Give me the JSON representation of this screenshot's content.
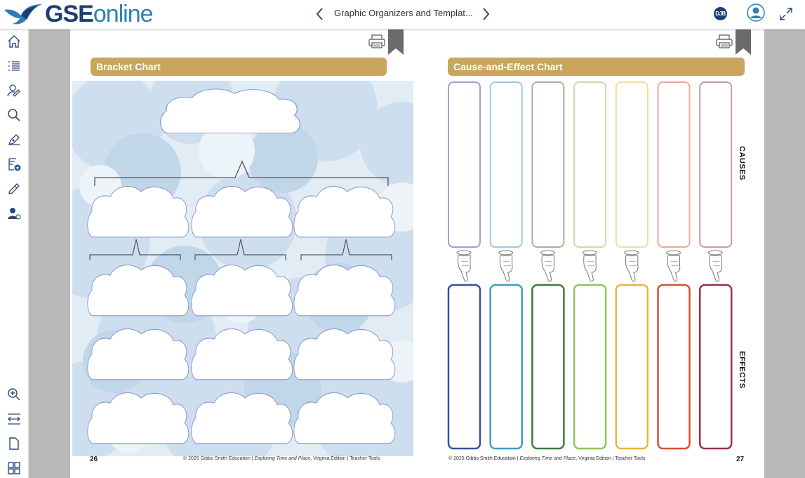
{
  "header": {
    "logo_gse": "GSE",
    "logo_online": "online",
    "doc_title": "Graphic Organizers and Templat...",
    "badge": "DJB"
  },
  "icons": {
    "prev": "chevron-left-icon",
    "next": "chevron-right-icon",
    "avatar": "user-avatar-icon",
    "expand": "fullscreen-expand-icon"
  },
  "sidebar": {
    "items": [
      "home",
      "table-of-contents",
      "student-work",
      "search",
      "annotate",
      "notes-add",
      "highlight",
      "assign",
      "zoom-in",
      "fit-width",
      "single-page",
      "thumbnails"
    ]
  },
  "left_page": {
    "banner": "Bracket Chart",
    "page_number": "26",
    "copyright_pre": "© 2025 Gibbs Smith Education | ",
    "copyright_italic": "Exploring Time and Place",
    "copyright_post": ", Virginia Edition | Teacher Tools"
  },
  "right_page": {
    "banner": "Cause-and-Effect Chart",
    "page_number": "27",
    "copyright_pre": "© 2025 Gibbs Smith Education | ",
    "copyright_italic": "Exploring Time and Place",
    "copyright_post": ", Virginia Edition | Teacher Tools",
    "causes_label": "CAUSES",
    "effects_label": "EFFECTS"
  },
  "colors": {
    "banner": "#c9a65c",
    "brand_dark": "#1c3f73",
    "brand_light": "#2d80b7",
    "cloud_bg": "#cfe0ef",
    "cause_colors": [
      "#a99ad0",
      "#9cc9de",
      "#9db89b",
      "#c7dea8",
      "#f2dc98",
      "#f2a696",
      "#c79aa8"
    ],
    "effect_colors": [
      "#3b4f9c",
      "#3e9fbf",
      "#3e7a3e",
      "#8fc45a",
      "#e8b83a",
      "#d94f34",
      "#9b2f4d"
    ]
  }
}
